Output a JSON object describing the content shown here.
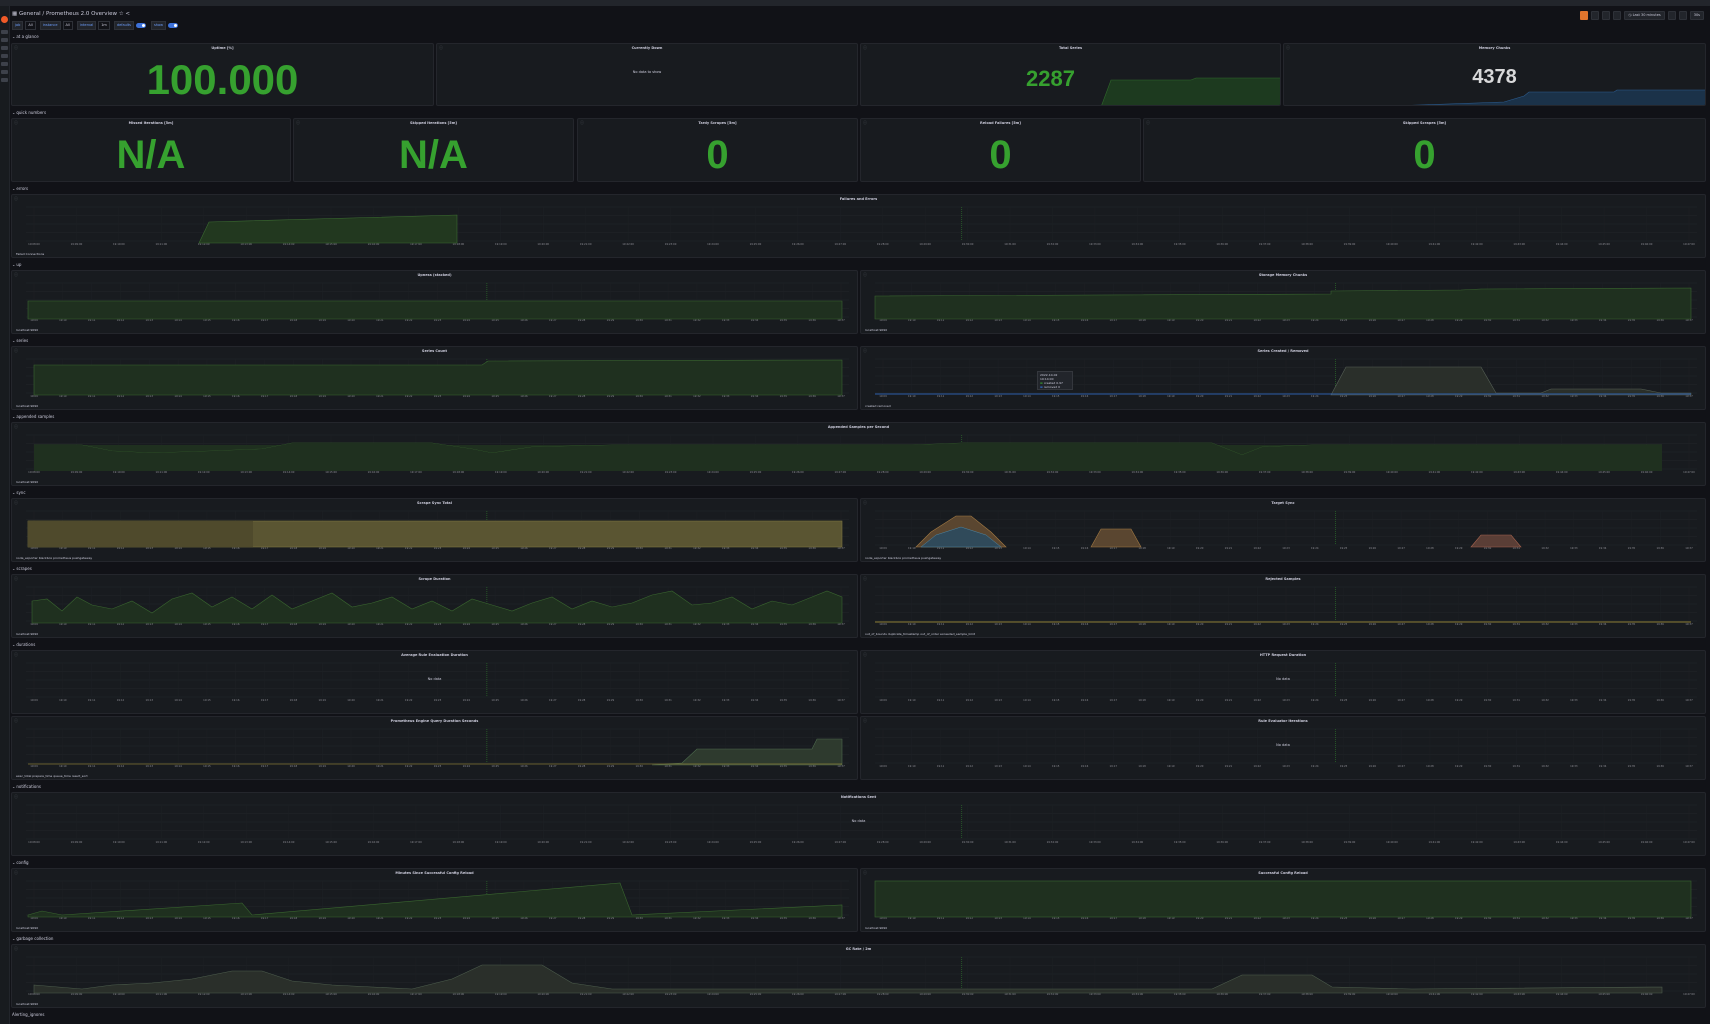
{
  "header": {
    "breadcrumb": "General / Prometheus 2.0 Overview",
    "time_range": "Last 30 minutes",
    "refresh": "30s"
  },
  "variables": [
    {
      "label": "job",
      "value": "All"
    },
    {
      "label": "instance",
      "value": "All"
    },
    {
      "label": "interval",
      "value": "1m"
    },
    {
      "label": "defaults",
      "value": ""
    },
    {
      "label": "show",
      "value": ""
    }
  ],
  "rows": {
    "at_a_glance": "at a glance",
    "quick_numbers": "quick numbers",
    "errors": "errors",
    "up": "up",
    "series": "series",
    "appended_samples": "appended samples",
    "sync": "sync",
    "scrapes": "scrapes",
    "durations": "durations",
    "notifications": "notifications",
    "config": "config",
    "garbage_collection": "garbage collection",
    "alerting": "Alerting_ignores"
  },
  "panels": {
    "uptime": {
      "title": "Uptime [%]",
      "value": "100.000"
    },
    "currently_down": {
      "title": "Currently Down",
      "nodata": "No data to show"
    },
    "total_series": {
      "title": "Total Series",
      "value": "2287"
    },
    "memory_chunks": {
      "title": "Memory Chunks",
      "value": "4378"
    },
    "missed_iterations": {
      "title": "Missed Iterations [5m]",
      "value": "N/A"
    },
    "skipped_iterations": {
      "title": "Skipped Iterations [5m]",
      "value": "N/A"
    },
    "tardy_scrapes": {
      "title": "Tardy Scrapes [5m]",
      "value": "0"
    },
    "reload_failures": {
      "title": "Reload Failures [5m]",
      "value": "0"
    },
    "skipped_scrapes": {
      "title": "Skipped Scrapes [5m]",
      "value": "0"
    },
    "failures_errors": {
      "title": "Failures and Errors",
      "legend": "Failed Connections"
    },
    "upness": {
      "title": "Upness (stacked)",
      "legend": "localhost:9090"
    },
    "storage_memory_chunks": {
      "title": "Storage Memory Chunks",
      "legend": "localhost:9090"
    },
    "series_count": {
      "title": "Series Count",
      "legend": "localhost:9090"
    },
    "series_created_removed": {
      "title": "Series Created / Removed",
      "legend": "created  removed"
    },
    "appended_samples": {
      "title": "Appended Samples per Second",
      "legend": "localhost:9090"
    },
    "scrape_sync_total": {
      "title": "Scrape Sync Total",
      "legend": "node_exporter  blackbox  prometheus  pushgateway"
    },
    "target_sync": {
      "title": "Target Sync",
      "legend": "node_exporter  blackbox  prometheus  pushgateway"
    },
    "scrape_duration": {
      "title": "Scrape Duration",
      "legend": "localhost:9090"
    },
    "rejected_samples": {
      "title": "Rejected Samples",
      "legend": "out_of_bounds  duplicate_timestamp  out_of_order  exceeded_sample_limit"
    },
    "avg_rule_eval": {
      "title": "Average Rule Evaluation Duration",
      "nodata": "No data"
    },
    "http_request": {
      "title": "HTTP Request Duration",
      "nodata": "No data"
    },
    "query_engine": {
      "title": "Prometheus Engine Query Duration Seconds",
      "legend": "exec_total  prepare_time  queue_time  result_sort"
    },
    "rule_eval": {
      "title": "Rule Evaluator Iterations",
      "nodata": "No data"
    },
    "notifications_sent": {
      "title": "Notifications Sent",
      "nodata": "No data"
    },
    "minutes_since_reload": {
      "title": "Minutes Since Successful Config Reload",
      "legend": "localhost:9090"
    },
    "successful_reload": {
      "title": "Successful Config Reload",
      "legend": "localhost:9090"
    },
    "gc_rate": {
      "title": "GC Rate / 2m",
      "legend": "localhost:9090"
    }
  },
  "tooltip": {
    "time": "2022-10-02 19:14:00",
    "created_label": "created",
    "created_value": "0.97",
    "removed_label": "removed",
    "removed_value": "0"
  },
  "x_ticks_full": [
    "19:08:00",
    "19:09:00",
    "19:10:00",
    "19:11:00",
    "19:12:00",
    "19:13:00",
    "19:14:00",
    "19:15:00",
    "19:16:00",
    "19:17:00",
    "19:18:00",
    "19:19:00",
    "19:20:00",
    "19:21:00",
    "19:22:00",
    "19:23:00",
    "19:24:00",
    "19:25:00",
    "19:26:00",
    "19:27:00",
    "19:28:00",
    "19:29:00",
    "19:30:00",
    "19:31:00",
    "19:32:00",
    "19:33:00",
    "19:34:00",
    "19:35:00",
    "19:36:00",
    "19:37:00",
    "19:38:00",
    "19:39:00",
    "19:40:00",
    "19:41:00",
    "19:42:00",
    "19:43:00",
    "19:44:00",
    "19:45:00",
    "19:46:00",
    "19:47:00"
  ],
  "x_ticks_half": [
    "19:09",
    "19:10",
    "19:11",
    "19:12",
    "19:13",
    "19:14",
    "19:15",
    "19:16",
    "19:17",
    "19:18",
    "19:19",
    "19:20",
    "19:21",
    "19:22",
    "19:23",
    "19:24",
    "19:25",
    "19:26",
    "19:27",
    "19:28",
    "19:29",
    "19:30",
    "19:31",
    "19:32",
    "19:33",
    "19:34",
    "19:35",
    "19:36",
    "19:37"
  ],
  "colors": {
    "green": "#36a12f",
    "blue": "#3274d9",
    "yellow": "#b4a13e",
    "orange": "#e0752d",
    "bg": "#111217"
  }
}
